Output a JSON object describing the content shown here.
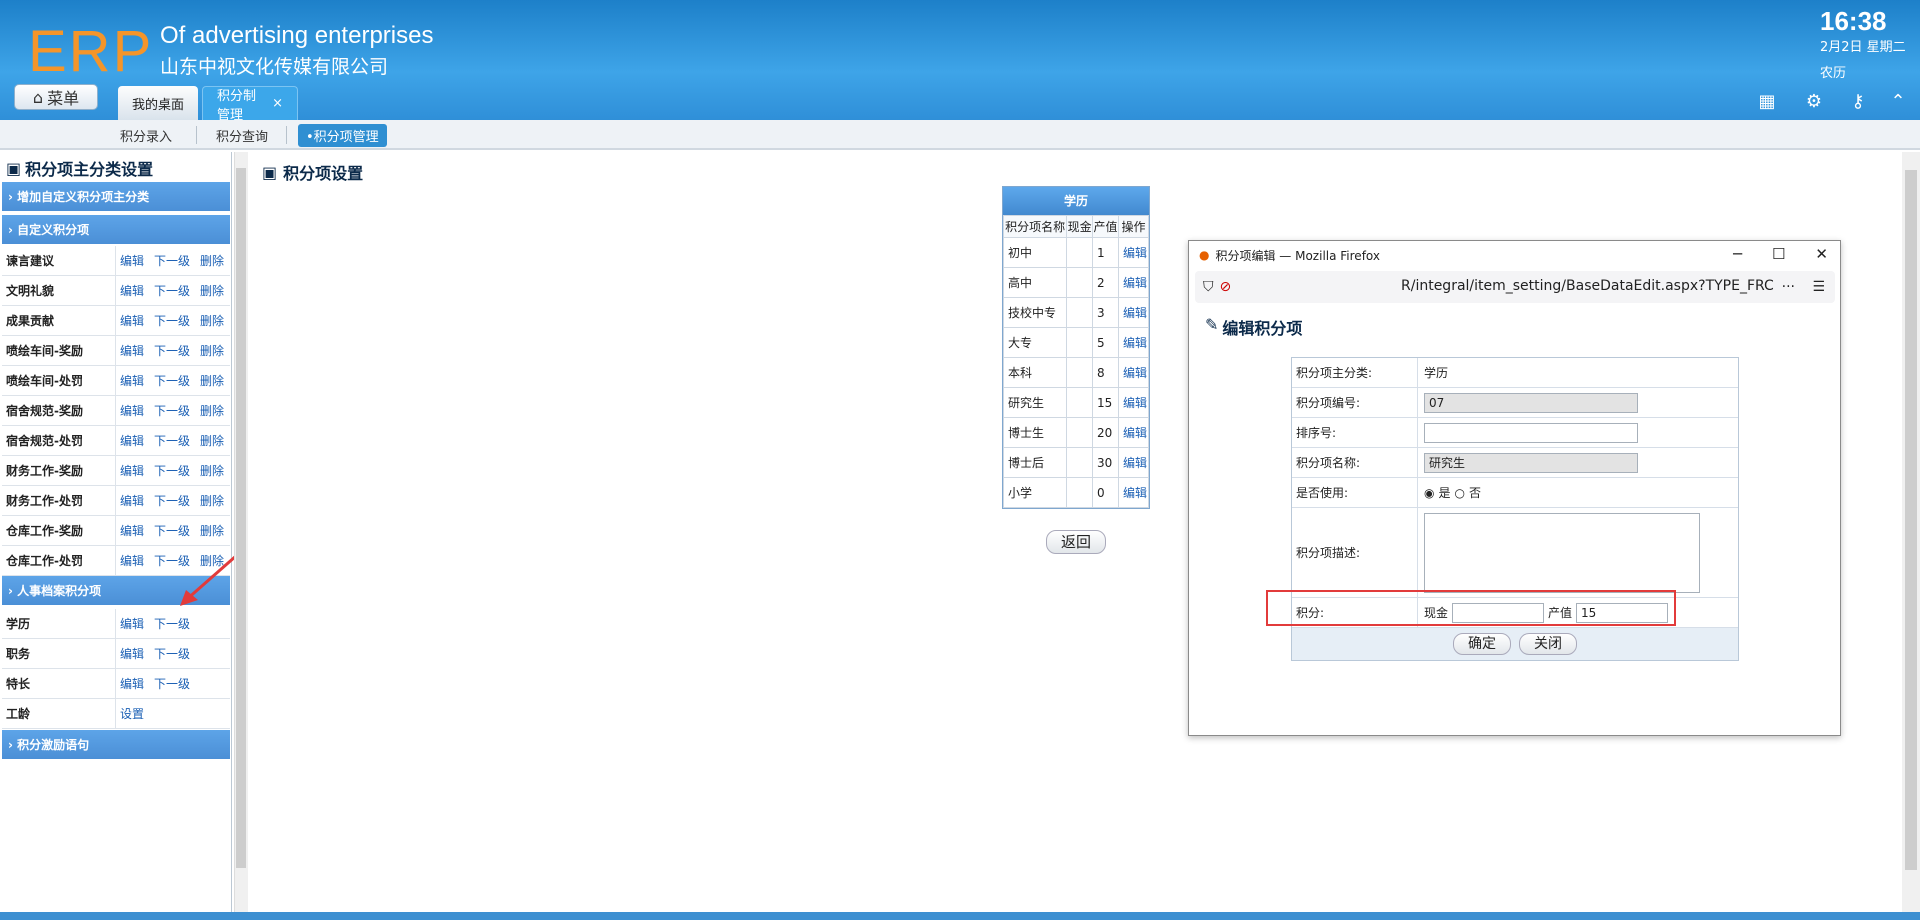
{
  "header": {
    "logo": "ERP",
    "tagline": "Of advertising enterprises",
    "company": "山东中视文化传媒有限公司",
    "time": "16:38",
    "date": "2月2日 星期二",
    "lunar": "农历",
    "menu_label": "菜单",
    "tabs": [
      {
        "label": "我的桌面"
      },
      {
        "label": "积分制管理",
        "close": "×"
      }
    ]
  },
  "subnav": {
    "items": [
      "积分录入",
      "积分查询",
      "•积分项管理"
    ]
  },
  "left": {
    "title": "积分项主分类设置",
    "group_add": "增加自定义积分项主分类",
    "group_custom": "自定义积分项",
    "group_hr": "人事档案积分项",
    "group_msg": "积分激励语句",
    "actions": {
      "edit": "编辑",
      "next": "下一级",
      "del": "删除",
      "set": "设置"
    },
    "custom_items": [
      "谏言建议",
      "文明礼貌",
      "成果贡献",
      "喷绘车间-奖励",
      "喷绘车间-处罚",
      "宿舍规范-奖励",
      "宿舍规范-处罚",
      "财务工作-奖励",
      "财务工作-处罚",
      "仓库工作-奖励",
      "仓库工作-处罚"
    ],
    "hr_items": [
      "学历",
      "职务",
      "特长",
      "工龄"
    ]
  },
  "main": {
    "title": "积分项设置",
    "table_title": "学历",
    "columns": [
      "积分项名称",
      "现金",
      "产值",
      "操作"
    ],
    "rows": [
      {
        "name": "初中",
        "cash": "",
        "value": "1",
        "op": "编辑"
      },
      {
        "name": "高中",
        "cash": "",
        "value": "2",
        "op": "编辑"
      },
      {
        "name": "技校中专",
        "cash": "",
        "value": "3",
        "op": "编辑"
      },
      {
        "name": "大专",
        "cash": "",
        "value": "5",
        "op": "编辑"
      },
      {
        "name": "本科",
        "cash": "",
        "value": "8",
        "op": "编辑"
      },
      {
        "name": "研究生",
        "cash": "",
        "value": "15",
        "op": "编辑"
      },
      {
        "name": "博士生",
        "cash": "",
        "value": "20",
        "op": "编辑"
      },
      {
        "name": "博士后",
        "cash": "",
        "value": "30",
        "op": "编辑"
      },
      {
        "name": "小学",
        "cash": "",
        "value": "0",
        "op": "编辑"
      }
    ],
    "back": "返回"
  },
  "popup": {
    "window_title": "积分项编辑 — Mozilla Firefox",
    "url": "R/integral/item_setting/BaseDataEdit.aspx?TYPE_FRC",
    "heading": "编辑积分项",
    "labels": {
      "main_cat": "积分项主分类:",
      "code": "积分项编号:",
      "sort": "排序号:",
      "name": "积分项名称:",
      "enabled": "是否使用:",
      "desc": "积分项描述:",
      "points": "积分:"
    },
    "values": {
      "main_cat": "学历",
      "code": "07",
      "sort": "",
      "name": "研究生",
      "yes": "是",
      "no": "否",
      "cash_label": "现金",
      "cash": "",
      "value_label": "产值",
      "value": "15"
    },
    "ok": "确定",
    "close": "关闭"
  }
}
